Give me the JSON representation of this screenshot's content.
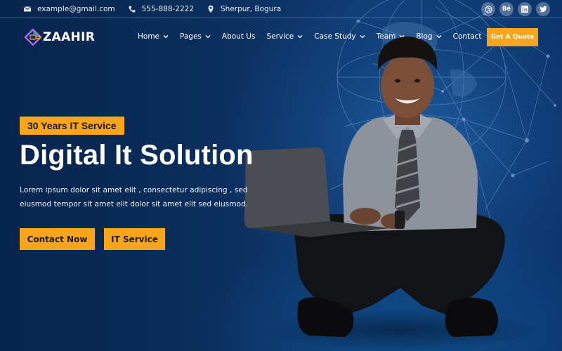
{
  "topbar": {
    "email": "example@gmail.com",
    "phone": "555-888-2222",
    "location": "Sherpur, Bogura",
    "icons": [
      "envelope-icon",
      "phone-icon",
      "map-pin-icon"
    ],
    "socials": [
      {
        "name": "dribbble",
        "glyph": "◎"
      },
      {
        "name": "behance",
        "glyph": "Bē"
      },
      {
        "name": "linkedin",
        "glyph": "in"
      },
      {
        "name": "twitter",
        "glyph": "🐦"
      }
    ]
  },
  "brand": {
    "name": "ZAAHIR"
  },
  "nav": {
    "items": [
      {
        "label": "Home",
        "dropdown": true
      },
      {
        "label": "Pages",
        "dropdown": true
      },
      {
        "label": "About Us",
        "dropdown": false
      },
      {
        "label": "Service",
        "dropdown": true
      },
      {
        "label": "Case Study",
        "dropdown": true
      },
      {
        "label": "Team",
        "dropdown": true
      },
      {
        "label": "Blog",
        "dropdown": true
      },
      {
        "label": "Contact",
        "dropdown": false
      }
    ],
    "cta": "Get A Quote"
  },
  "hero": {
    "badge": "30 Years IT Service",
    "title": "Digital It Solution",
    "description": "Lorem ipsum dolor sit amet elit , consectetur adipiscing , sed eiusmod tempor sit amet elit dolor sit amet elit sed eiusmod.",
    "primary_button": "Contact Now",
    "secondary_button": "IT Service"
  },
  "colors": {
    "accent": "#f9a51c",
    "background": "#0b2f5e",
    "text": "#ffffff"
  }
}
